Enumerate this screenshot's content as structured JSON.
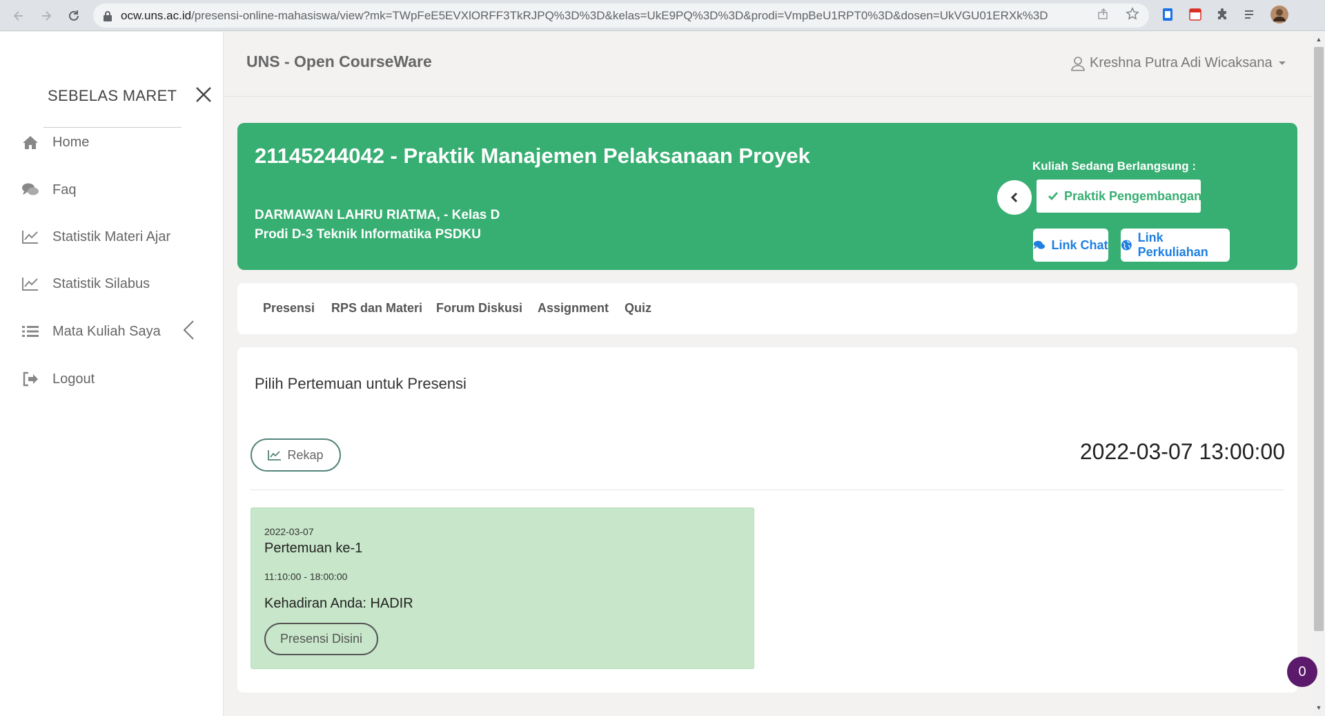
{
  "browser": {
    "url_host": "ocw.uns.ac.id",
    "url_path": "/presensi-online-mahasiswa/view?mk=TWpFeE5EVXlORFF3TkRJPQ%3D%3D&kelas=UkE9PQ%3D%3D&prodi=VmpBeU1RPT0%3D&dosen=UkVGU01ERXk%3D"
  },
  "sidebar": {
    "brand": "SEBELAS MARET",
    "items": [
      {
        "label": "Home",
        "icon": "home-icon"
      },
      {
        "label": "Faq",
        "icon": "comments-icon"
      },
      {
        "label": "Statistik Materi Ajar",
        "icon": "line-chart-icon"
      },
      {
        "label": "Statistik Silabus",
        "icon": "line-chart-icon"
      },
      {
        "label": "Mata Kuliah Saya",
        "icon": "list-icon"
      },
      {
        "label": "Logout",
        "icon": "sign-out-icon"
      }
    ]
  },
  "header": {
    "app_title": "UNS - Open CourseWare",
    "user_name": "Kreshna Putra Adi Wicaksana"
  },
  "banner": {
    "course_title": "21145244042 - Praktik Manajemen Pelaksanaan Proyek",
    "lecturer": "DARMAWAN LAHRU RIATMA, - Kelas D",
    "prodi": "Prodi D-3 Teknik Informatika PSDKU",
    "ongoing_label": "Kuliah Sedang Berlangsung :",
    "ongoing_course": "Praktik Pengembangan Aplikasi",
    "link_chat": "Link Chat",
    "link_perkuliahan": "Link Perkuliahan",
    "color": "#37ae72"
  },
  "tabs": [
    "Presensi",
    "RPS dan Materi",
    "Forum Diskusi",
    "Assignment",
    "Quiz"
  ],
  "main": {
    "section_title": "Pilih Pertemuan untuk Presensi",
    "rekap_label": "Rekap",
    "clock": "2022-03-07 13:00:00",
    "meeting": {
      "date": "2022-03-07",
      "title": "Pertemuan ke-1",
      "time": "11:10:00 - 18:00:00",
      "status": "Kehadiran Anda: HADIR",
      "button": "Presensi Disini"
    }
  },
  "notification_count": "0"
}
